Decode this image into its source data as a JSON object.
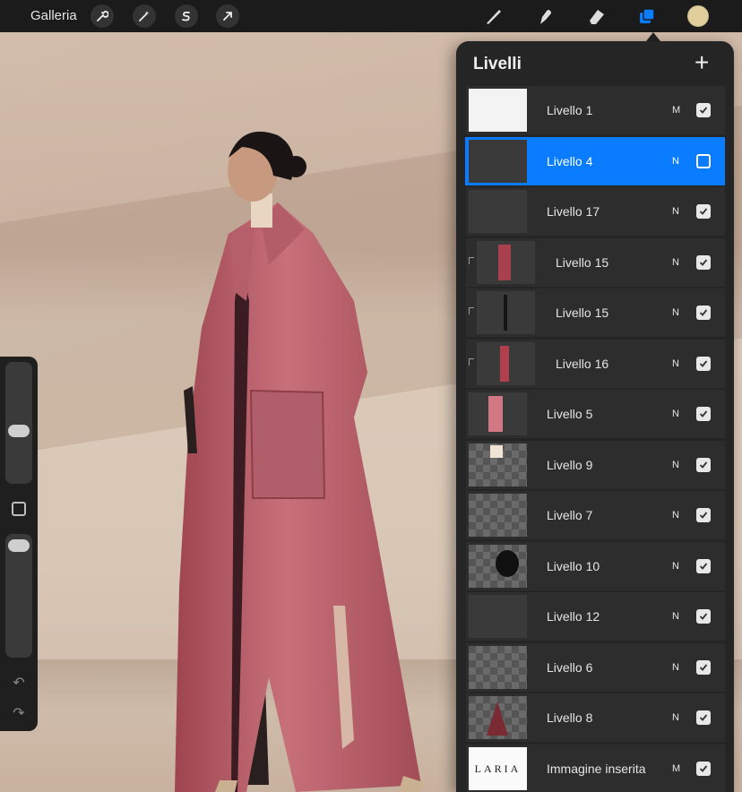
{
  "toolbar": {
    "gallery_label": "Galleria",
    "left_icons": [
      "wrench-icon",
      "magic-wand-icon",
      "selection-icon",
      "transform-arrow-icon"
    ],
    "right_icons": [
      "brush-icon",
      "smudge-icon",
      "eraser-icon",
      "layers-icon"
    ],
    "accent": "#0a7cff",
    "current_color": "#e0cf9d"
  },
  "layers_panel": {
    "title": "Livelli",
    "add_label": "+",
    "layers": [
      {
        "name": "Livello 1",
        "mode": "M",
        "visible": true,
        "selected": false,
        "clipped": false
      },
      {
        "name": "Livello 4",
        "mode": "N",
        "visible": false,
        "selected": true,
        "clipped": false
      },
      {
        "name": "Livello 17",
        "mode": "N",
        "visible": true,
        "selected": false,
        "clipped": false
      },
      {
        "name": "Livello 15",
        "mode": "N",
        "visible": true,
        "selected": false,
        "clipped": true
      },
      {
        "name": "Livello 15",
        "mode": "N",
        "visible": true,
        "selected": false,
        "clipped": true
      },
      {
        "name": "Livello 16",
        "mode": "N",
        "visible": true,
        "selected": false,
        "clipped": true
      },
      {
        "name": "Livello 5",
        "mode": "N",
        "visible": true,
        "selected": false,
        "clipped": false
      },
      {
        "name": "Livello 9",
        "mode": "N",
        "visible": true,
        "selected": false,
        "clipped": false
      },
      {
        "name": "Livello 7",
        "mode": "N",
        "visible": true,
        "selected": false,
        "clipped": false
      },
      {
        "name": "Livello 10",
        "mode": "N",
        "visible": true,
        "selected": false,
        "clipped": false
      },
      {
        "name": "Livello 12",
        "mode": "N",
        "visible": true,
        "selected": false,
        "clipped": false
      },
      {
        "name": "Livello 6",
        "mode": "N",
        "visible": true,
        "selected": false,
        "clipped": false
      },
      {
        "name": "Livello 8",
        "mode": "N",
        "visible": true,
        "selected": false,
        "clipped": false
      },
      {
        "name": "Immagine inserita",
        "mode": "M",
        "visible": true,
        "selected": false,
        "clipped": false
      }
    ]
  },
  "inserted_image_text": "LARIA"
}
